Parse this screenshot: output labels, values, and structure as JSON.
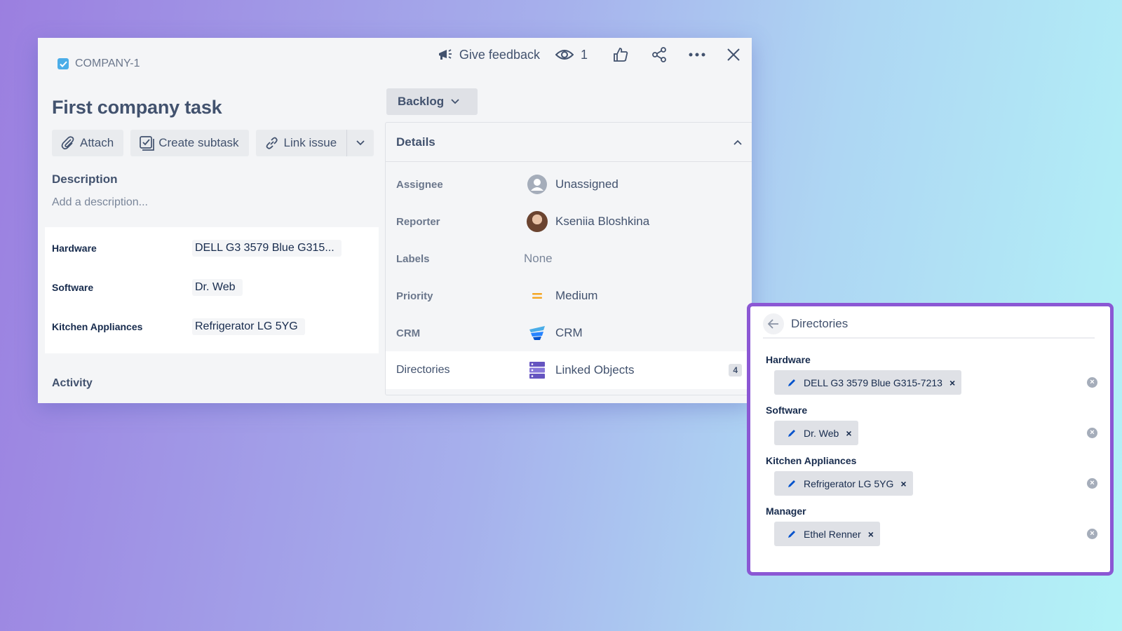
{
  "issue": {
    "key": "COMPANY-1",
    "title": "First company task",
    "actions": {
      "attach": "Attach",
      "create_subtask": "Create subtask",
      "link_issue": "Link issue"
    },
    "description_heading": "Description",
    "description_placeholder": "Add a description...",
    "fields": [
      {
        "label": "Hardware",
        "value": "DELL G3 3579 Blue G315..."
      },
      {
        "label": "Software",
        "value": "Dr. Web"
      },
      {
        "label": "Kitchen Appliances",
        "value": "Refrigerator LG 5YG"
      }
    ],
    "activity_heading": "Activity"
  },
  "toolbar": {
    "feedback_label": "Give feedback",
    "watch_count": "1"
  },
  "status": {
    "label": "Backlog"
  },
  "details": {
    "heading": "Details",
    "assignee": {
      "label": "Assignee",
      "value": "Unassigned"
    },
    "reporter": {
      "label": "Reporter",
      "value": "Kseniia Bloshkina"
    },
    "labels": {
      "label": "Labels",
      "value": "None"
    },
    "priority": {
      "label": "Priority",
      "value": "Medium"
    },
    "crm": {
      "label": "CRM",
      "value": "CRM"
    },
    "directories": {
      "label": "Directories",
      "value": "Linked Objects",
      "count": "4"
    }
  },
  "directories_panel": {
    "title": "Directories",
    "groups": [
      {
        "label": "Hardware",
        "item": "DELL G3 3579 Blue G315-7213"
      },
      {
        "label": "Software",
        "item": "Dr. Web"
      },
      {
        "label": "Kitchen Appliances",
        "item": "Refrigerator LG 5YG"
      },
      {
        "label": "Manager",
        "item": "Ethel Renner"
      }
    ]
  },
  "colors": {
    "accent_purple": "#8b57d4",
    "checkbox_blue": "#4bade8",
    "priority_medium": "#f5a623",
    "pen_blue": "#0052cc"
  }
}
